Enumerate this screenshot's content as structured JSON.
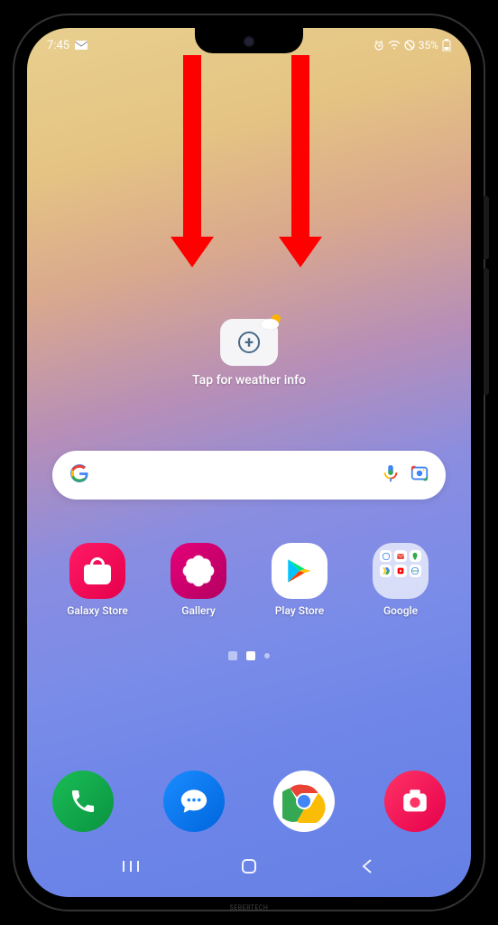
{
  "status": {
    "time": "7:45",
    "battery_text": "35%"
  },
  "weather": {
    "label": "Tap for weather info"
  },
  "apps": [
    {
      "label": "Galaxy Store"
    },
    {
      "label": "Gallery"
    },
    {
      "label": "Play Store"
    },
    {
      "label": "Google"
    }
  ],
  "watermark": "SEBERTECH"
}
